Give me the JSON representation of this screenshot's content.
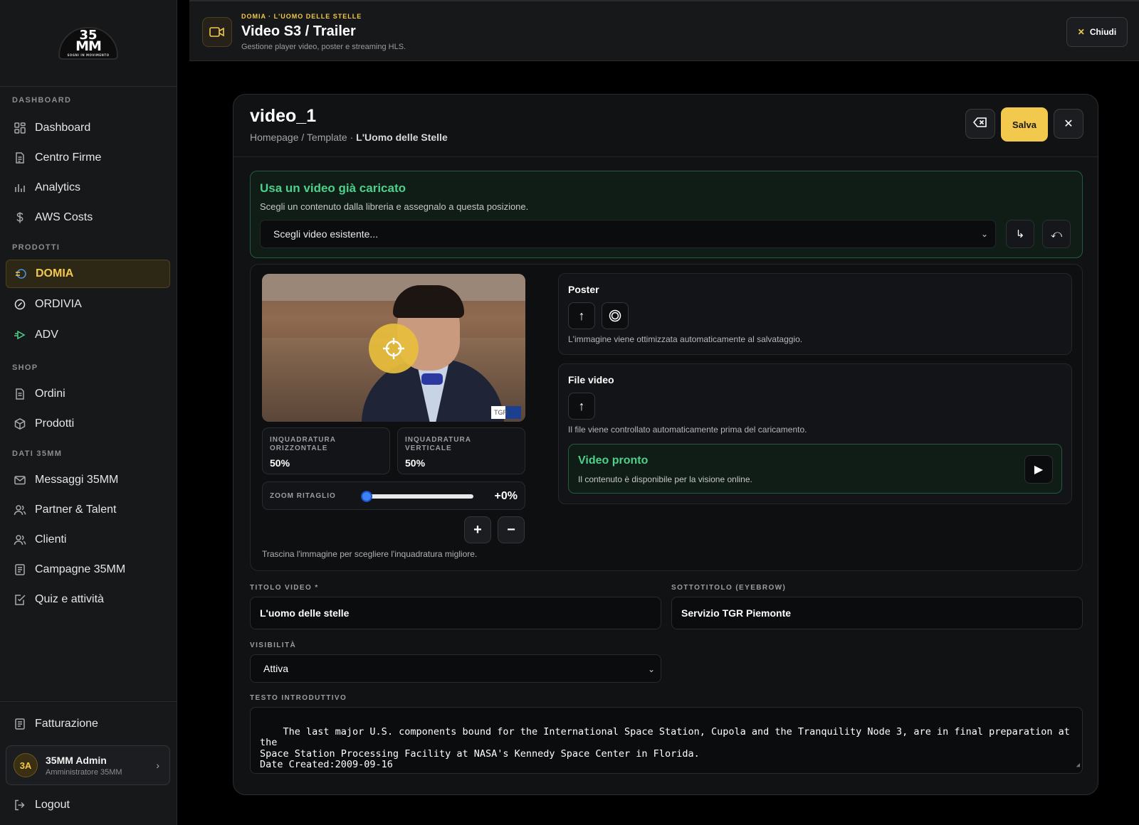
{
  "sidebar": {
    "logo": {
      "line1": "35",
      "line2": "MM",
      "tagline": "SOGNI IN MOVIMENTO"
    },
    "sections": [
      {
        "title": "DASHBOARD",
        "items": [
          {
            "label": "Dashboard",
            "icon": "grid-icon"
          },
          {
            "label": "Centro Firme",
            "icon": "document-icon"
          },
          {
            "label": "Analytics",
            "icon": "bar-chart-icon"
          },
          {
            "label": "AWS Costs",
            "icon": "dollar-icon"
          }
        ]
      },
      {
        "title": "PRODOTTI",
        "items": [
          {
            "label": "DOMIA",
            "icon": "domia-icon",
            "active": true
          },
          {
            "label": "ORDIVIA",
            "icon": "ordivia-icon"
          },
          {
            "label": "ADV",
            "icon": "adv-icon"
          }
        ]
      },
      {
        "title": "SHOP",
        "items": [
          {
            "label": "Ordini",
            "icon": "receipt-icon"
          },
          {
            "label": "Prodotti",
            "icon": "box-icon"
          }
        ]
      },
      {
        "title": "DATI 35MM",
        "items": [
          {
            "label": "Messaggi 35MM",
            "icon": "mail-icon"
          },
          {
            "label": "Partner & Talent",
            "icon": "users-icon"
          },
          {
            "label": "Clienti",
            "icon": "users-icon"
          },
          {
            "label": "Campagne 35MM",
            "icon": "campaign-icon"
          },
          {
            "label": "Quiz e attività",
            "icon": "checklist-icon"
          }
        ]
      }
    ],
    "billing": {
      "label": "Fatturazione",
      "icon": "invoice-icon"
    },
    "user": {
      "initials": "3A",
      "name": "35MM Admin",
      "role": "Amministratore 35MM"
    },
    "logout": {
      "label": "Logout",
      "icon": "logout-icon"
    }
  },
  "header": {
    "eyebrow": "DOMIA · L'UOMO DELLE STELLE",
    "title": "Video S3 / Trailer",
    "subtitle": "Gestione player video, poster e streaming HLS.",
    "close_label": "Chiudi"
  },
  "modal": {
    "title": "video_1",
    "breadcrumb": {
      "path": "Homepage / Template · ",
      "current": "L'Uomo delle Stelle"
    },
    "save_label": "Salva",
    "library": {
      "title": "Usa un video già caricato",
      "subtitle": "Scegli un contenuto dalla libreria e assegnalo a questa posizione.",
      "select_value": "Scegli video esistente..."
    },
    "preview": {
      "badge": "TGR",
      "framing_h": {
        "label": "INQUADRATURA ORIZZONTALE",
        "value": "50%"
      },
      "framing_v": {
        "label": "INQUADRATURA VERTICALE",
        "value": "50%"
      },
      "zoom": {
        "label": "ZOOM RITAGLIO",
        "value_text": "+0%",
        "level": 0
      },
      "hint": "Trascina l'immagine per scegliere l'inquadratura migliore."
    },
    "poster": {
      "title": "Poster",
      "hint": "L'immagine viene ottimizzata automaticamente al salvataggio."
    },
    "video_file": {
      "title": "File video",
      "hint": "Il file viene controllato automaticamente prima del caricamento.",
      "ready_title": "Video pronto",
      "ready_sub": "Il contenuto è disponibile per la visione online."
    },
    "fields": {
      "title_label": "TITOLO VIDEO *",
      "title_value": "L'uomo delle stelle",
      "eyebrow_label": "SOTTOTITOLO (EYEBROW)",
      "eyebrow_value": "Servizio TGR Piemonte",
      "visibility_label": "VISIBILITÀ",
      "visibility_value": "Attiva",
      "intro_label": "TESTO INTRODUTTIVO",
      "intro_value": "The last major U.S. components bound for the International Space Station, Cupola and the Tranquility Node 3, are in final preparation at the\nSpace Station Processing Facility at NASA's Kennedy Space Center in Florida.\nDate Created:2009-09-16"
    }
  },
  "colors": {
    "accent": "#f2c94c",
    "success": "#4ed08a",
    "slider": "#3b82f6"
  }
}
